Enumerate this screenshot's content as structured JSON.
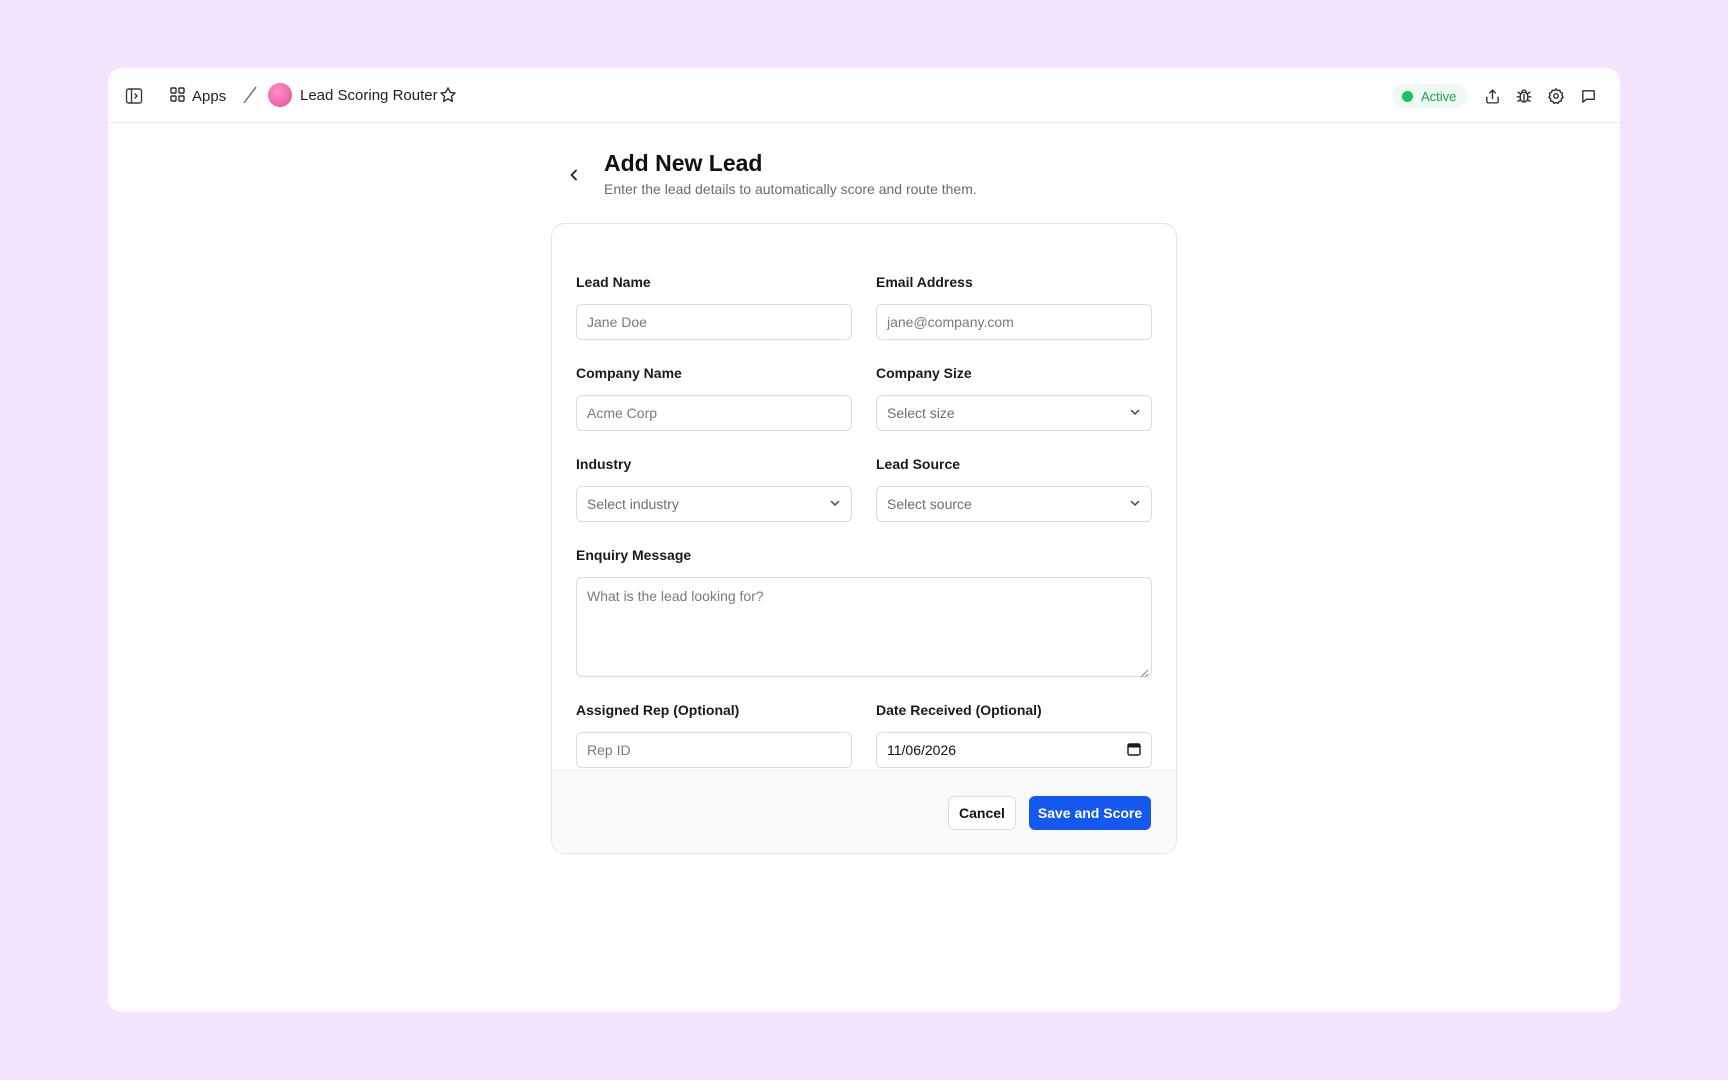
{
  "header": {
    "apps_label": "Apps",
    "app_title": "Lead Scoring Router",
    "status": "Active",
    "icons": {
      "sidebar": "sidebar-toggle-icon",
      "apps": "grid-icon",
      "favorite": "star-icon",
      "share": "share-icon",
      "debug": "bug-icon",
      "settings": "gear-icon",
      "chat": "chat-icon"
    },
    "colors": {
      "status": "#16a34a",
      "app_dot": "#e44e9e"
    }
  },
  "page": {
    "title": "Add New Lead",
    "subtitle": "Enter the lead details to automatically score and route them."
  },
  "form": {
    "lead_name": {
      "label": "Lead Name",
      "placeholder": "Jane Doe"
    },
    "email": {
      "label": "Email Address",
      "placeholder": "jane@company.com"
    },
    "company_name": {
      "label": "Company Name",
      "placeholder": "Acme Corp"
    },
    "company_size": {
      "label": "Company Size",
      "value": "Select size"
    },
    "industry": {
      "label": "Industry",
      "value": "Select industry"
    },
    "lead_source": {
      "label": "Lead Source",
      "value": "Select source"
    },
    "enquiry": {
      "label": "Enquiry Message",
      "placeholder": "What is the lead looking for?"
    },
    "assigned_rep": {
      "label": "Assigned Rep (Optional)",
      "placeholder": "Rep ID"
    },
    "date_received": {
      "label": "Date Received (Optional)",
      "value": "11/06/2026"
    }
  },
  "actions": {
    "cancel_label": "Cancel",
    "save_label": "Save and Score",
    "primary_color": "#1558f0"
  }
}
